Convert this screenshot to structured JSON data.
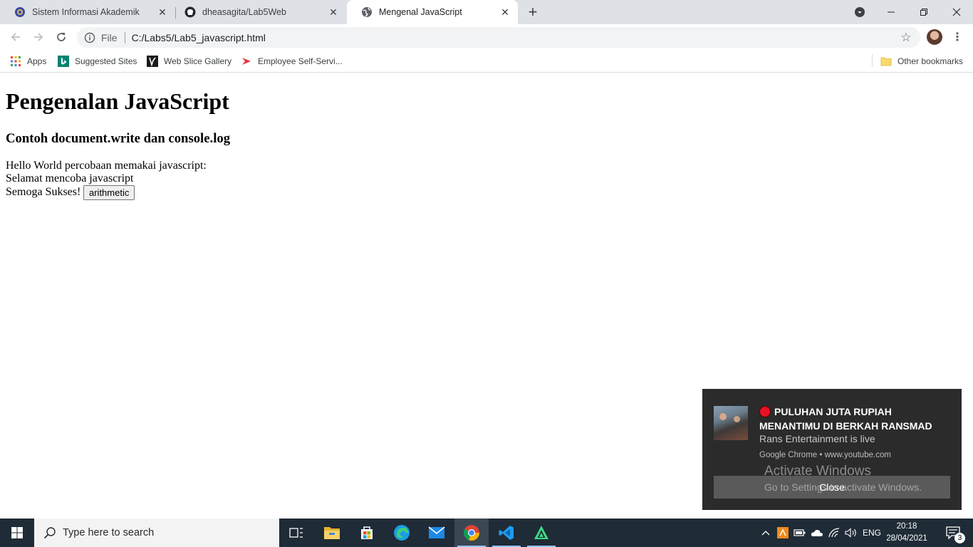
{
  "browser": {
    "tabs": [
      {
        "title": "Sistem Informasi Akademik",
        "icon": "university-logo-icon",
        "active": false
      },
      {
        "title": "dheasagita/Lab5Web",
        "icon": "github-icon",
        "active": false
      },
      {
        "title": "Mengenal JavaScript",
        "icon": "globe-icon",
        "active": true
      }
    ],
    "address": {
      "scheme": "File",
      "url": "C:/Labs5/Lab5_javascript.html"
    },
    "bookmarks": [
      {
        "label": "Apps",
        "icon": "apps-grid-icon"
      },
      {
        "label": "Suggested Sites",
        "icon": "bing-icon"
      },
      {
        "label": "Web Slice Gallery",
        "icon": "web-slice-icon"
      },
      {
        "label": "Employee Self-Servi...",
        "icon": "arrow-logo-icon"
      }
    ],
    "other_bookmarks": "Other bookmarks"
  },
  "page": {
    "heading": "Pengenalan JavaScript",
    "subheading": "Contoh document.write dan console.log",
    "lines": [
      "Hello World percobaan memakai javascript:",
      "Selamat mencoba javascript",
      "Semoga Sukses!"
    ],
    "button_label": "arithmetic"
  },
  "notification": {
    "title": "PULUHAN JUTA RUPIAH MENANTIMU DI BERKAH RANSMAD",
    "subtitle": "Rans Entertainment is live",
    "source": "Google Chrome • www.youtube.com",
    "close_label": "Close",
    "live_color": "#e81123"
  },
  "watermark": {
    "line1": "Activate Windows",
    "line2": "Go to Settings to activate Windows."
  },
  "taskbar": {
    "search_placeholder": "Type here to search",
    "apps": [
      "task-view-icon",
      "file-explorer-icon",
      "store-icon",
      "edge-icon",
      "mail-icon",
      "chrome-icon",
      "vscode-icon",
      "android-studio-icon"
    ],
    "language": "ENG",
    "time": "20:18",
    "date": "28/04/2021",
    "notification_count": "3",
    "accent": "#8ec5f4"
  }
}
